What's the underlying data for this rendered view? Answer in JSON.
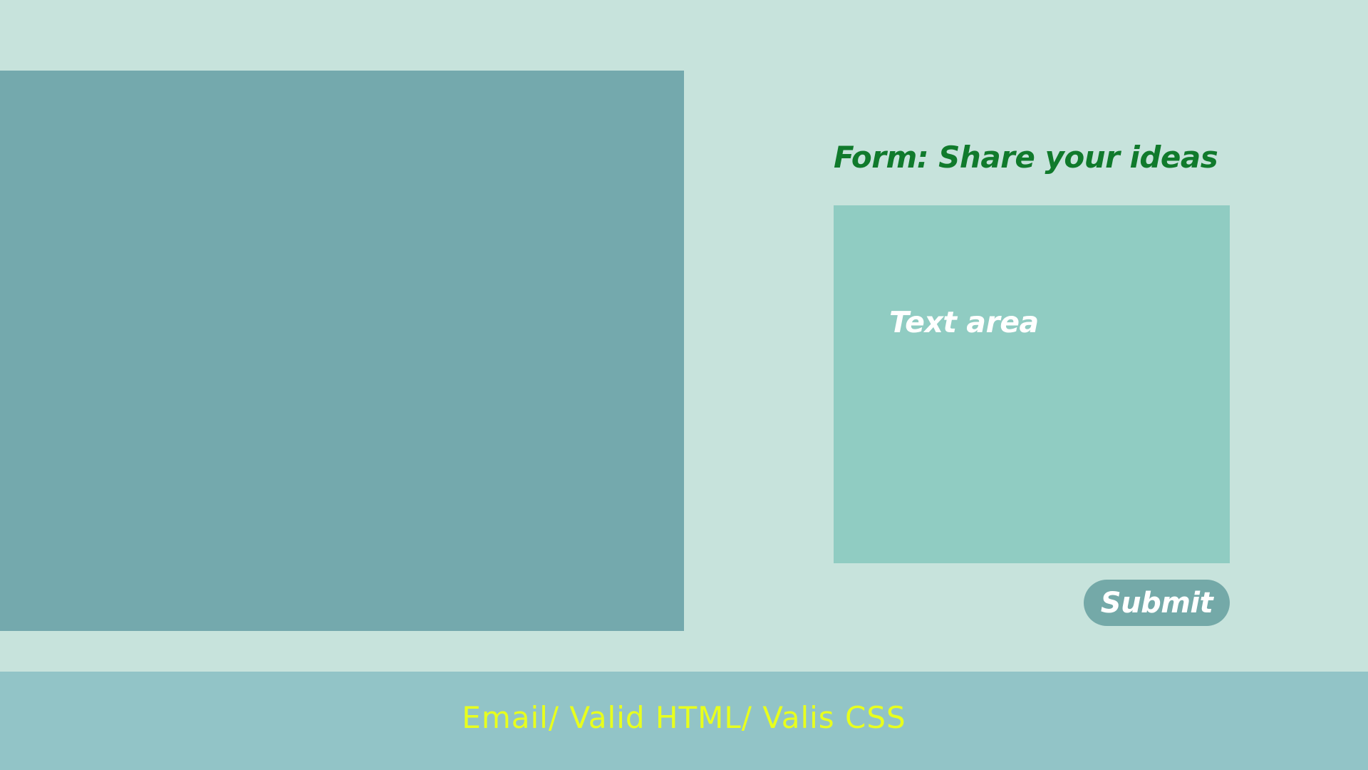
{
  "colors": {
    "page_background": "#c7e3dc",
    "image_panel": "#74a9ad",
    "text_area_background": "#90ccc2",
    "title_text": "#107a2c",
    "button_background": "#74a9a8",
    "button_text": "#ffffff",
    "footer_background": "#92c4c7",
    "footer_text": "#e8ff1d"
  },
  "form": {
    "title": "Form: Share your ideas",
    "text_area_label": "Text area",
    "submit_label": "Submit"
  },
  "footer": {
    "text": "Email/ Valid HTML/ Valis CSS"
  }
}
